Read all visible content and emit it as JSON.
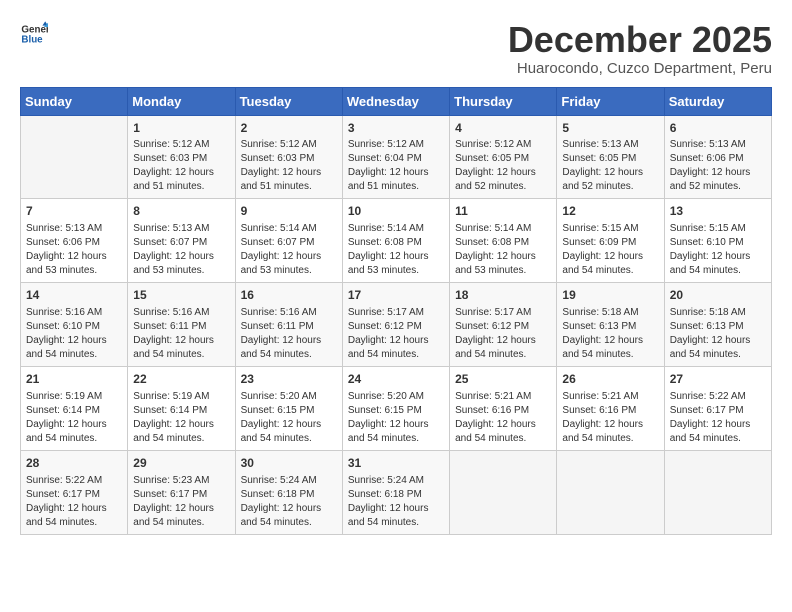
{
  "logo": {
    "text_general": "General",
    "text_blue": "Blue"
  },
  "title": {
    "month_year": "December 2025",
    "location": "Huarocondo, Cuzco Department, Peru"
  },
  "calendar": {
    "headers": [
      "Sunday",
      "Monday",
      "Tuesday",
      "Wednesday",
      "Thursday",
      "Friday",
      "Saturday"
    ],
    "weeks": [
      [
        {
          "day": "",
          "info": ""
        },
        {
          "day": "1",
          "info": "Sunrise: 5:12 AM\nSunset: 6:03 PM\nDaylight: 12 hours\nand 51 minutes."
        },
        {
          "day": "2",
          "info": "Sunrise: 5:12 AM\nSunset: 6:03 PM\nDaylight: 12 hours\nand 51 minutes."
        },
        {
          "day": "3",
          "info": "Sunrise: 5:12 AM\nSunset: 6:04 PM\nDaylight: 12 hours\nand 51 minutes."
        },
        {
          "day": "4",
          "info": "Sunrise: 5:12 AM\nSunset: 6:05 PM\nDaylight: 12 hours\nand 52 minutes."
        },
        {
          "day": "5",
          "info": "Sunrise: 5:13 AM\nSunset: 6:05 PM\nDaylight: 12 hours\nand 52 minutes."
        },
        {
          "day": "6",
          "info": "Sunrise: 5:13 AM\nSunset: 6:06 PM\nDaylight: 12 hours\nand 52 minutes."
        }
      ],
      [
        {
          "day": "7",
          "info": "Sunrise: 5:13 AM\nSunset: 6:06 PM\nDaylight: 12 hours\nand 53 minutes."
        },
        {
          "day": "8",
          "info": "Sunrise: 5:13 AM\nSunset: 6:07 PM\nDaylight: 12 hours\nand 53 minutes."
        },
        {
          "day": "9",
          "info": "Sunrise: 5:14 AM\nSunset: 6:07 PM\nDaylight: 12 hours\nand 53 minutes."
        },
        {
          "day": "10",
          "info": "Sunrise: 5:14 AM\nSunset: 6:08 PM\nDaylight: 12 hours\nand 53 minutes."
        },
        {
          "day": "11",
          "info": "Sunrise: 5:14 AM\nSunset: 6:08 PM\nDaylight: 12 hours\nand 53 minutes."
        },
        {
          "day": "12",
          "info": "Sunrise: 5:15 AM\nSunset: 6:09 PM\nDaylight: 12 hours\nand 54 minutes."
        },
        {
          "day": "13",
          "info": "Sunrise: 5:15 AM\nSunset: 6:10 PM\nDaylight: 12 hours\nand 54 minutes."
        }
      ],
      [
        {
          "day": "14",
          "info": "Sunrise: 5:16 AM\nSunset: 6:10 PM\nDaylight: 12 hours\nand 54 minutes."
        },
        {
          "day": "15",
          "info": "Sunrise: 5:16 AM\nSunset: 6:11 PM\nDaylight: 12 hours\nand 54 minutes."
        },
        {
          "day": "16",
          "info": "Sunrise: 5:16 AM\nSunset: 6:11 PM\nDaylight: 12 hours\nand 54 minutes."
        },
        {
          "day": "17",
          "info": "Sunrise: 5:17 AM\nSunset: 6:12 PM\nDaylight: 12 hours\nand 54 minutes."
        },
        {
          "day": "18",
          "info": "Sunrise: 5:17 AM\nSunset: 6:12 PM\nDaylight: 12 hours\nand 54 minutes."
        },
        {
          "day": "19",
          "info": "Sunrise: 5:18 AM\nSunset: 6:13 PM\nDaylight: 12 hours\nand 54 minutes."
        },
        {
          "day": "20",
          "info": "Sunrise: 5:18 AM\nSunset: 6:13 PM\nDaylight: 12 hours\nand 54 minutes."
        }
      ],
      [
        {
          "day": "21",
          "info": "Sunrise: 5:19 AM\nSunset: 6:14 PM\nDaylight: 12 hours\nand 54 minutes."
        },
        {
          "day": "22",
          "info": "Sunrise: 5:19 AM\nSunset: 6:14 PM\nDaylight: 12 hours\nand 54 minutes."
        },
        {
          "day": "23",
          "info": "Sunrise: 5:20 AM\nSunset: 6:15 PM\nDaylight: 12 hours\nand 54 minutes."
        },
        {
          "day": "24",
          "info": "Sunrise: 5:20 AM\nSunset: 6:15 PM\nDaylight: 12 hours\nand 54 minutes."
        },
        {
          "day": "25",
          "info": "Sunrise: 5:21 AM\nSunset: 6:16 PM\nDaylight: 12 hours\nand 54 minutes."
        },
        {
          "day": "26",
          "info": "Sunrise: 5:21 AM\nSunset: 6:16 PM\nDaylight: 12 hours\nand 54 minutes."
        },
        {
          "day": "27",
          "info": "Sunrise: 5:22 AM\nSunset: 6:17 PM\nDaylight: 12 hours\nand 54 minutes."
        }
      ],
      [
        {
          "day": "28",
          "info": "Sunrise: 5:22 AM\nSunset: 6:17 PM\nDaylight: 12 hours\nand 54 minutes."
        },
        {
          "day": "29",
          "info": "Sunrise: 5:23 AM\nSunset: 6:17 PM\nDaylight: 12 hours\nand 54 minutes."
        },
        {
          "day": "30",
          "info": "Sunrise: 5:24 AM\nSunset: 6:18 PM\nDaylight: 12 hours\nand 54 minutes."
        },
        {
          "day": "31",
          "info": "Sunrise: 5:24 AM\nSunset: 6:18 PM\nDaylight: 12 hours\nand 54 minutes."
        },
        {
          "day": "",
          "info": ""
        },
        {
          "day": "",
          "info": ""
        },
        {
          "day": "",
          "info": ""
        }
      ]
    ]
  }
}
